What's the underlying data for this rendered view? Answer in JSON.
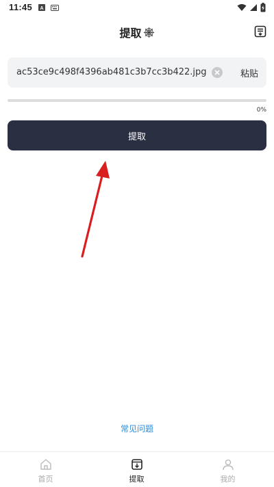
{
  "status_bar": {
    "time": "11:45",
    "left_icons": [
      "a-notification-icon",
      "keyboard-icon"
    ],
    "right_icons": [
      "wifi-icon",
      "signal-icon",
      "battery-charging-icon"
    ]
  },
  "header": {
    "title": "提取",
    "title_icon": "spider-web-icon",
    "history_icon": "history-list-icon"
  },
  "input": {
    "value": "ac53ce9c498f4396ab481c3b7cc3b422.jpg",
    "clear_icon": "clear-icon",
    "paste_label": "粘贴"
  },
  "progress": {
    "value": 0,
    "label": "0%"
  },
  "extract_button": {
    "label": "提取"
  },
  "faq": {
    "label": "常见问题"
  },
  "tabs": [
    {
      "label": "首页",
      "icon": "home-icon",
      "active": false
    },
    {
      "label": "提取",
      "icon": "inbox-download-icon",
      "active": true
    },
    {
      "label": "我的",
      "icon": "user-icon",
      "active": false
    }
  ],
  "colors": {
    "primary": "#2b2f42",
    "link": "#2e8bdb",
    "input_bg": "#f2f3f5",
    "annotation_arrow": "#d81e1e",
    "inactive_tab": "#aaaaaa"
  }
}
